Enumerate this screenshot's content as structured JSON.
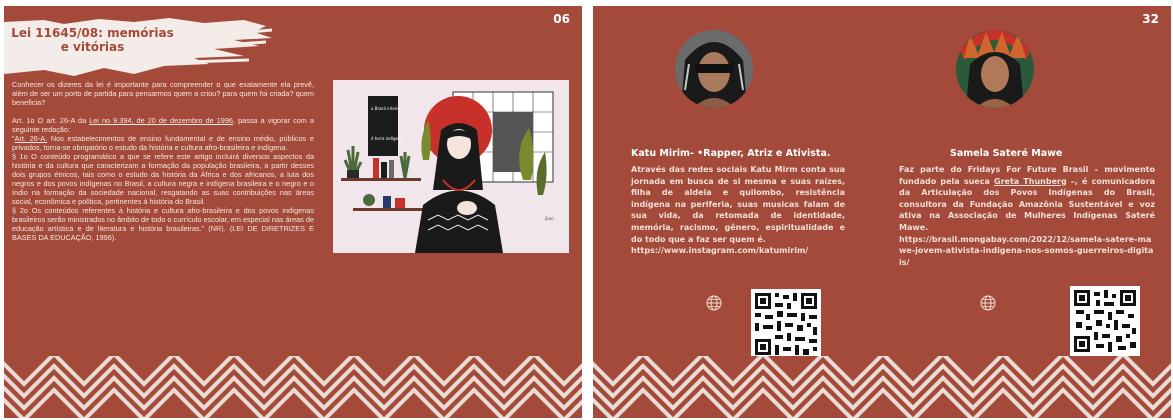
{
  "left_page": {
    "page_number": "06",
    "title": "Lei 11645/08: memórias e vitórias",
    "paragraph_1": "Conhecer os dizeres da lei é importante para compreender o que exatamente ela prevê, além de ser um porto de partida para pensarmos quem a criou? para quem foi criada? quem beneficia?",
    "p2_prefix": "Art. 1o O art. 26-A da ",
    "p2_link": "Lei no 9.394, de 20 de dezembro de 1996",
    "p2_suffix": ", passa a vigorar com a seguinte redação:",
    "p3_open": "\"",
    "p3_link": "Art. 26-A.",
    "p3_text": " Nos estabelecimentos de ensino fundamental e de ensino médio, públicos e privados, torna-se obrigatório o estudo da história e cultura afro-brasileira e indígena.",
    "paragraph_4": "§ 1o O conteúdo programático a que se refere este artigo incluirá diversos aspectos da história e da cultura que caracterizam a formação da população brasileira, a partir desses dois grupos étnicos, tais como o estudo da história da África e dos africanos, a luta dos negros e dos povos indígenas no Brasil, a cultura negra e indígena brasileira e o negro e o índio na formação da sociedade nacional, resgatando as suas contribuições nas áreas social, econômica e política, pertinentes à história do Brasil.",
    "paragraph_5": "§ 2o Os conteúdos referentes à história e cultura afro-brasileira e dos povos indígenas brasileiros serão ministrados no âmbito de todo o currículo escolar, em especial nas áreas de educação artística e de literatura e história brasileiras.\" (NR). (LEI DE DIRETRIZES E BASES DA EDUCAÇÃO, 1996).",
    "illustration": {
      "book_text_1": "o Brasil inteiro",
      "book_text_2": "é terra indígena",
      "signature": "jbaú"
    }
  },
  "right_page": {
    "page_number": "32",
    "person_1": {
      "name": "Katu Mirim- •Rapper, Atriz e Ativista.",
      "bio": "Através das redes sociais Katu Mirm conta sua jornada em busca de si mesma e suas raízes, filha de aldeia e quilombo, resistência indígena na periferia, suas musicas falam de sua vida, da retomada de identidade, memória, racismo, gênero, espiritualidade e do todo que a faz ser quem é.",
      "link": "https://www.instagram.com/katumirim/"
    },
    "person_2": {
      "name": "Samela Sateré Mawe",
      "bio_prefix": "Faz parte do Fridays For Future Brasil – movimento fundado pela sueca ",
      "bio_link": "Greta Thunberg",
      "bio_suffix": " –, é comunicadora da Articulação dos Povos Indígenas do Brasil, consultora da Fundação Amazônia Sustentável e voz ativa na Associação de Mulheres Indígenas Sateré Mawe.",
      "link": "https://brasil.mongabay.com/2022/12/samela-satere-mawe-jovem-ativista-indigena-nos-somos-guerreiros-digitais/"
    }
  },
  "colors": {
    "background": "#a34a3a",
    "text_light": "#f4e7e1",
    "pattern_light": "#e9dcd4",
    "accent_red": "#c8312a"
  },
  "icons": [
    "globe-icon",
    "qr-code"
  ]
}
